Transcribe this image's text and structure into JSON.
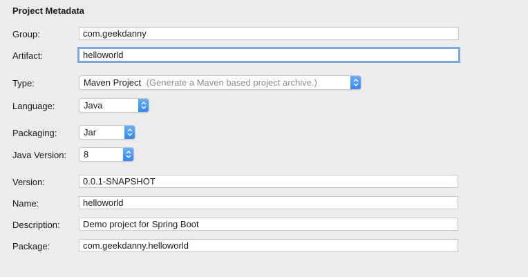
{
  "section_title": "Project Metadata",
  "fields": {
    "group": {
      "label": "Group:",
      "value": "com.geekdanny"
    },
    "artifact": {
      "label": "Artifact:",
      "value": "helloworld"
    },
    "type": {
      "label": "Type:",
      "value": "Maven Project",
      "hint": "(Generate a Maven based project archive.)"
    },
    "language": {
      "label": "Language:",
      "value": "Java"
    },
    "packaging": {
      "label": "Packaging:",
      "value": "Jar"
    },
    "java_version": {
      "label": "Java Version:",
      "value": "8"
    },
    "version": {
      "label": "Version:",
      "value": "0.0.1-SNAPSHOT"
    },
    "name": {
      "label": "Name:",
      "value": "helloworld"
    },
    "description": {
      "label": "Description:",
      "value": "Demo project for Spring Boot"
    },
    "package": {
      "label": "Package:",
      "value": "com.geekdanny.helloworld"
    }
  },
  "icons": {
    "dropdown": "up-down-chevron-icon"
  },
  "colors": {
    "background": "#ececec",
    "focus_ring": "#7aa7e0",
    "stepper": "#2f86f0"
  }
}
